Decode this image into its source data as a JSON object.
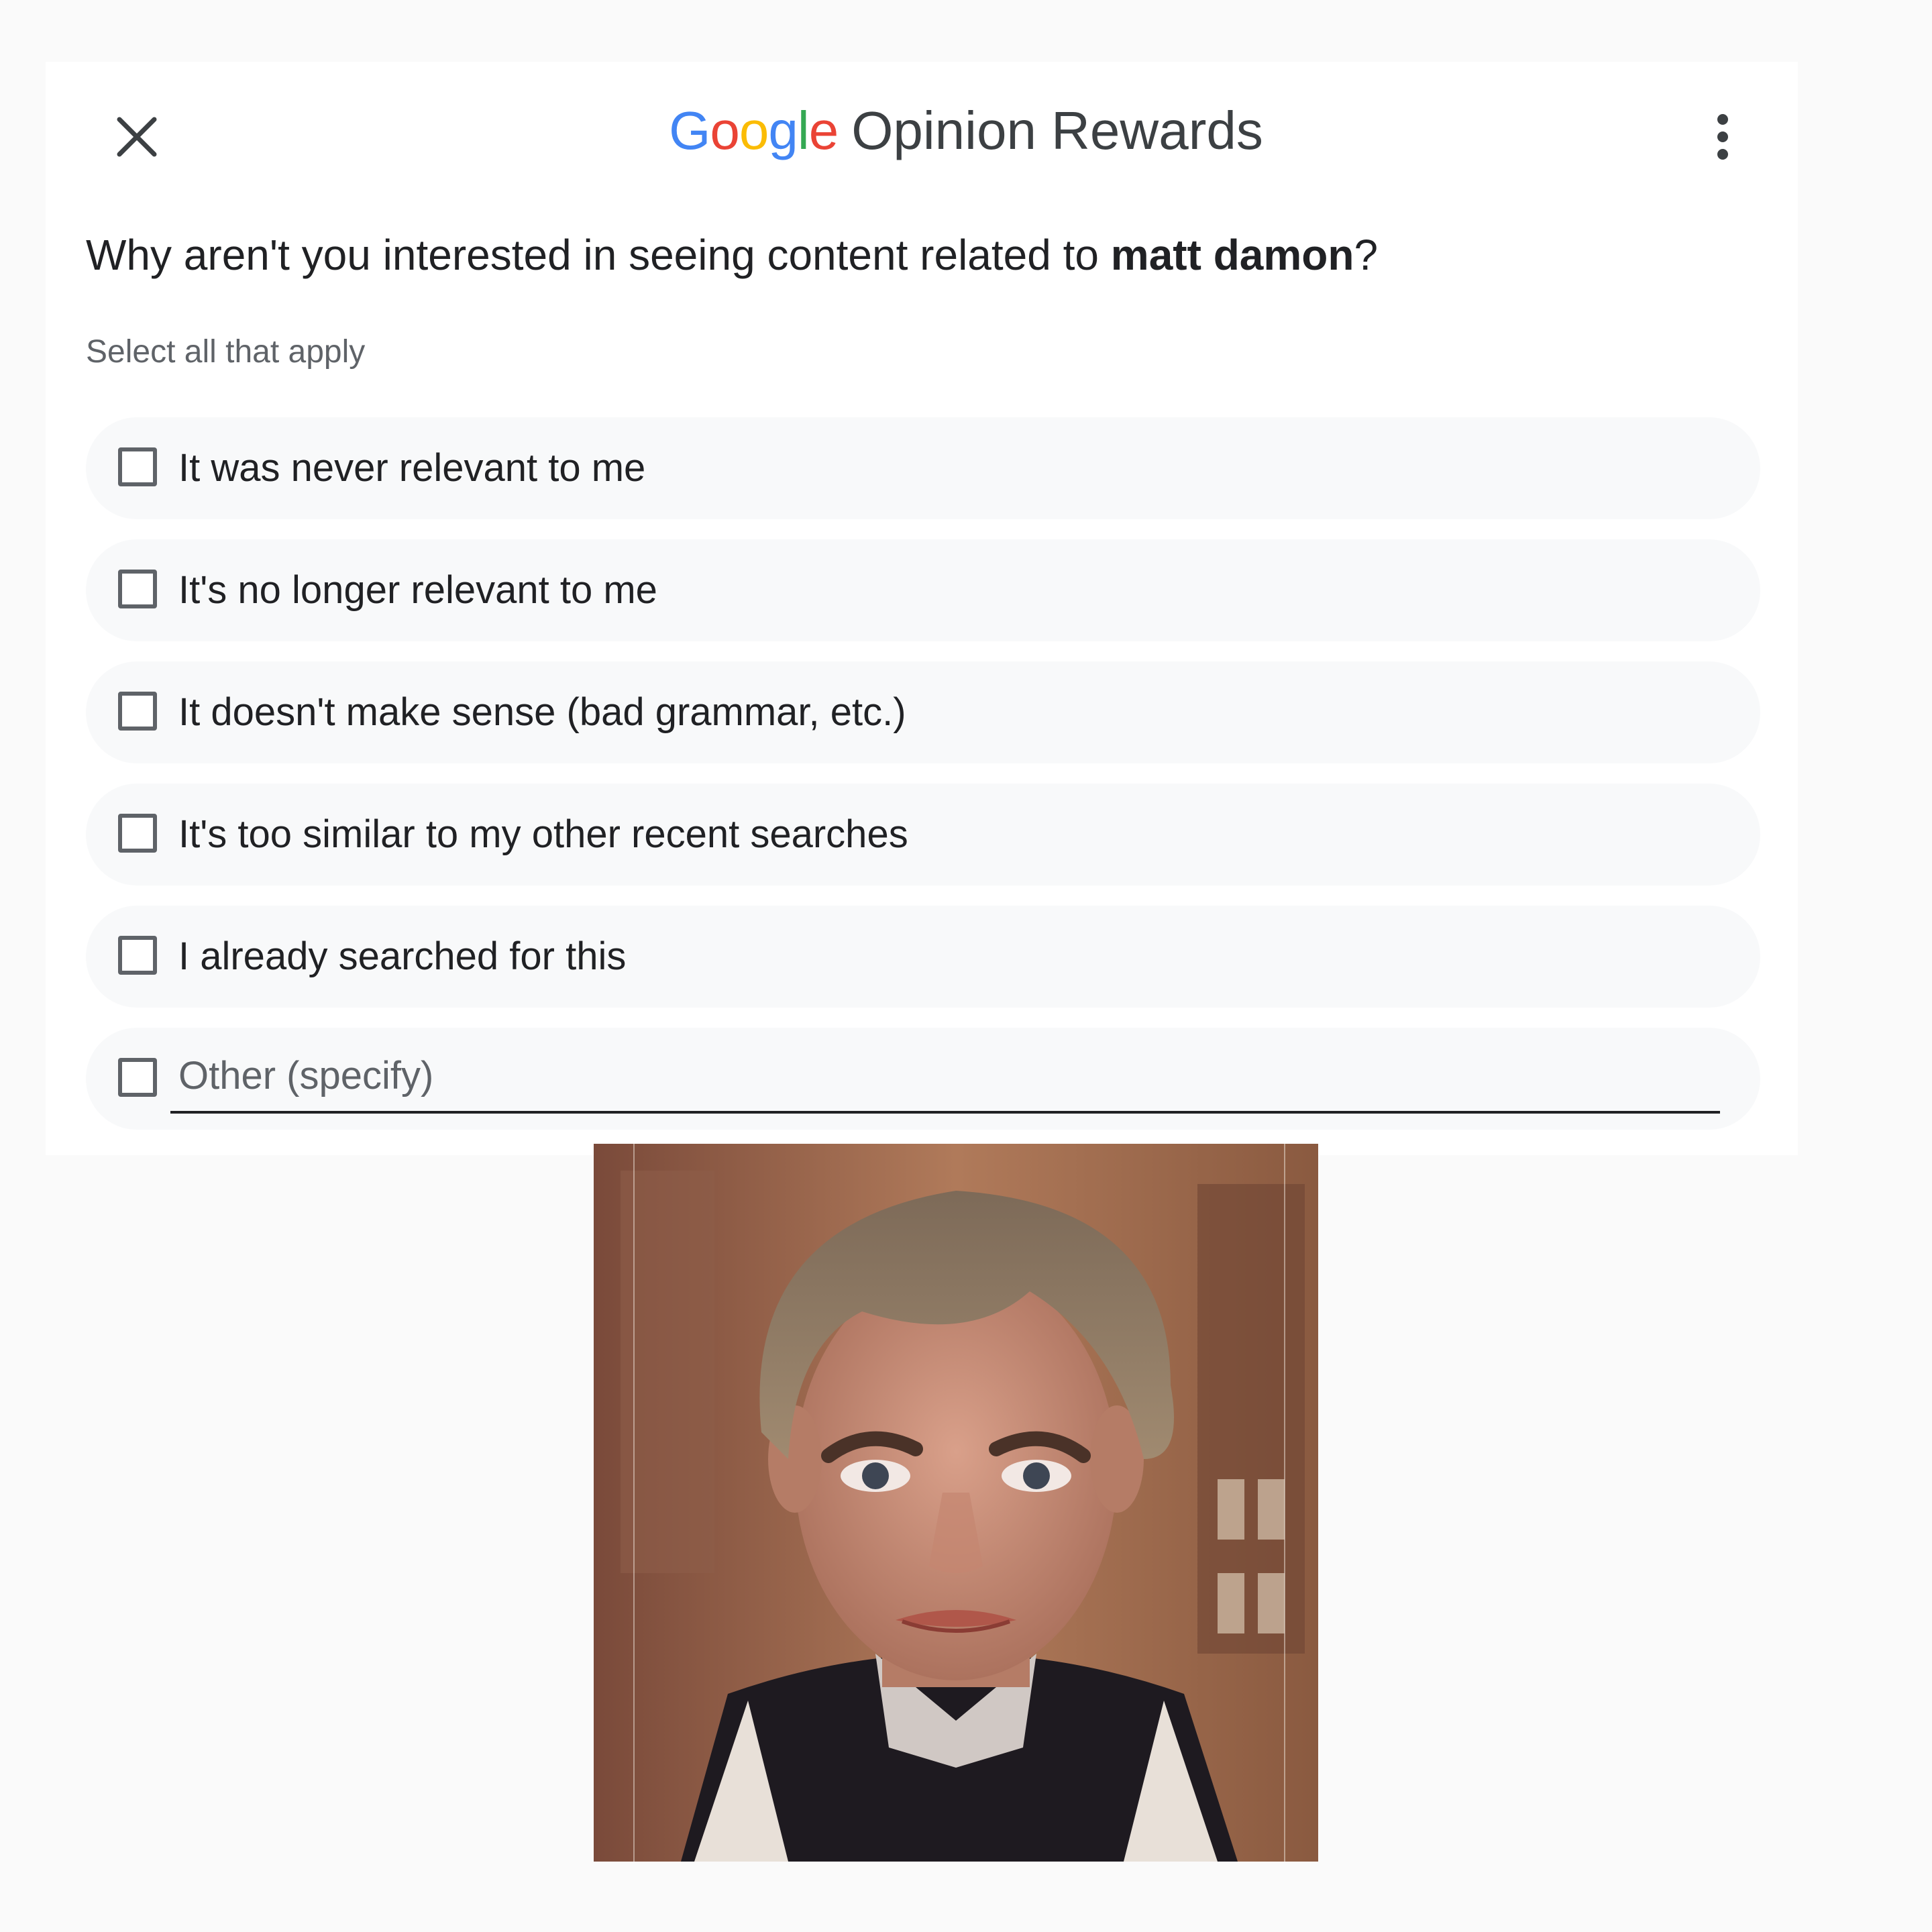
{
  "header": {
    "logo_text": "Google",
    "logo_letters": [
      "G",
      "o",
      "o",
      "g",
      "l",
      "e"
    ],
    "logo_colors": [
      "#4285F4",
      "#EA4335",
      "#FBBC05",
      "#4285F4",
      "#34A853",
      "#EA4335"
    ],
    "title": "Opinion Rewards",
    "close_icon": "close-icon",
    "menu_icon": "more-vert-icon"
  },
  "question": {
    "prefix": "Why aren't you interested in seeing content related to ",
    "topic": "matt damon",
    "suffix": "?"
  },
  "hint": "Select all that apply",
  "options": [
    {
      "label": "It was never relevant to me",
      "checked": false
    },
    {
      "label": "It's no longer relevant to me",
      "checked": false
    },
    {
      "label": "It doesn't make sense (bad grammar, etc.)",
      "checked": false
    },
    {
      "label": "It's too similar to my other recent searches",
      "checked": false
    },
    {
      "label": "I already searched for this",
      "checked": false
    }
  ],
  "other": {
    "placeholder": "Other (specify)",
    "value": "",
    "checked": false
  },
  "image": {
    "subject": "puppet-portrait"
  }
}
